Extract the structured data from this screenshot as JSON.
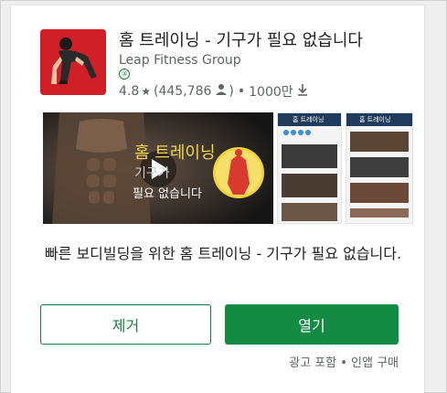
{
  "app": {
    "title": "홈 트레이닝 - 기구가 필요 없습니다",
    "developer": "Leap Fitness Group",
    "badge": "③",
    "rating": "4.8",
    "star": "★",
    "reviews_open": "(445,786",
    "reviews_close": ")",
    "separator": "•",
    "installs": "1000만",
    "icon_name": "pushup-app-icon",
    "brand_color": "#d11f27"
  },
  "media": {
    "video_title_line1": "홈 트레이닝",
    "video_title_line2": "기구가",
    "video_title_line3": "필요 없습니다",
    "screenshot1_header": "홈 트레이닝",
    "screenshot2_header": "홈 트레이닝"
  },
  "description": "빠른 보디빌딩을 위한 홈 트레이닝 - 기구가 필요 없습니다.",
  "actions": {
    "remove_label": "제거",
    "open_label": "열기",
    "accent": "#138b43"
  },
  "footnote": "광고 포함 • 인앱 구매"
}
